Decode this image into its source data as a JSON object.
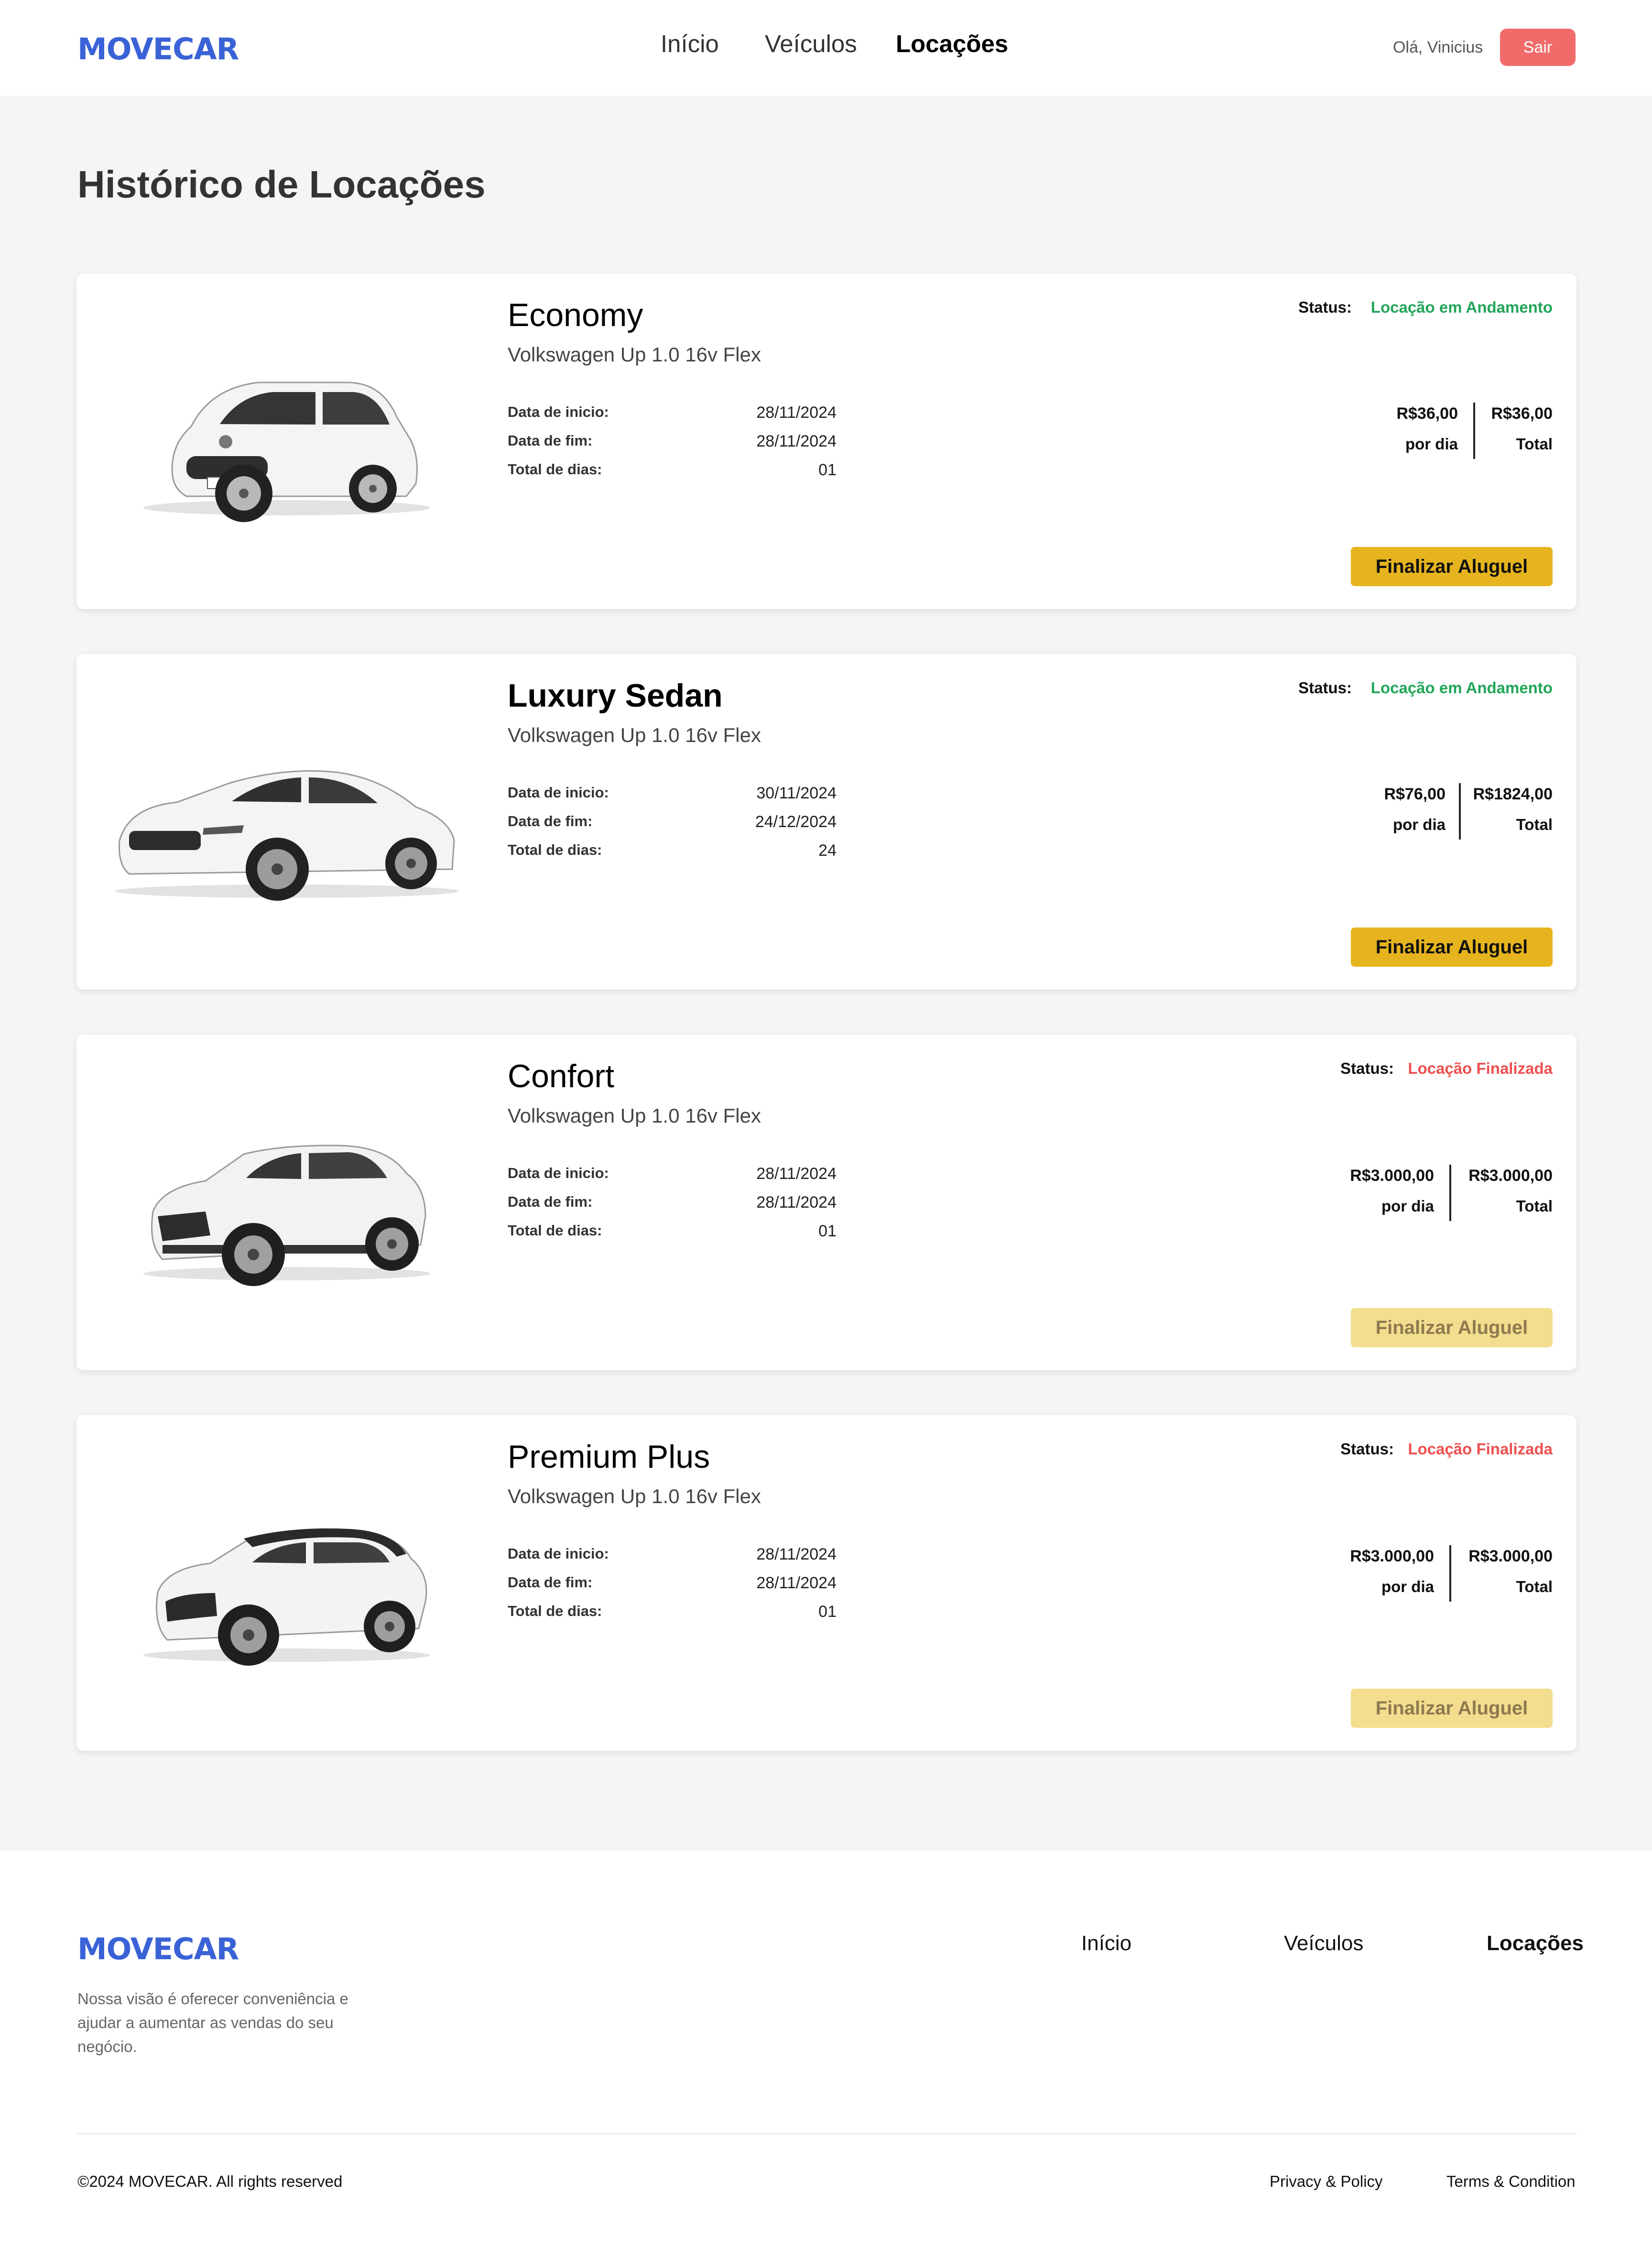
{
  "header": {
    "logo": "MOVECAR",
    "nav": [
      "Início",
      "Veículos",
      "Locações"
    ],
    "active_nav": "Locações",
    "greeting": "Olá, Vinicius",
    "logout_label": "Sair"
  },
  "page": {
    "title": "Histórico de Locações"
  },
  "labels": {
    "status": "Status:",
    "start": "Data de inicio:",
    "end": "Data de fim:",
    "days": "Total de dias:",
    "per_day": "por dia",
    "total": "Total",
    "finalize": "Finalizar Aluguel"
  },
  "rentals": [
    {
      "category": "Economy",
      "model": "Volkswagen Up 1.0 16v Flex",
      "status": "Locação em Andamento",
      "start": "28/11/2024",
      "end": "28/11/2024",
      "days": "01",
      "price_per_day": "R$36,00",
      "price_total": "R$36,00",
      "button_enabled": true
    },
    {
      "category": "Luxury Sedan",
      "model": "Volkswagen Up 1.0 16v Flex",
      "status": "Locação em Andamento",
      "start": "30/11/2024",
      "end": "24/12/2024",
      "days": "24",
      "price_per_day": "R$76,00",
      "price_total": "R$1824,00",
      "button_enabled": true
    },
    {
      "category": "Confort",
      "model": "Volkswagen Up 1.0 16v Flex",
      "status": "Locação Finalizada",
      "start": "28/11/2024",
      "end": "28/11/2024",
      "days": "01",
      "price_per_day": "R$3.000,00",
      "price_total": "R$3.000,00",
      "button_enabled": false
    },
    {
      "category": "Premium Plus",
      "model": "Volkswagen Up 1.0 16v Flex",
      "status": "Locação Finalizada",
      "start": "28/11/2024",
      "end": "28/11/2024",
      "days": "01",
      "price_per_day": "R$3.000,00",
      "price_total": "R$3.000,00",
      "button_enabled": false
    }
  ],
  "colors": {
    "brand": "#3a62d7",
    "status_active": "#22a559",
    "status_finished": "#ef4f4f",
    "button": "#e6b41e",
    "button_disabled": "#f3dd8e",
    "logout": "#f26b6b"
  },
  "footer": {
    "logo": "MOVECAR",
    "tagline": "Nossa visão é oferecer conveniência e ajudar a aumentar as vendas do seu negócio.",
    "nav": [
      "Início",
      "Veículos",
      "Locações"
    ],
    "copyright": "©2024 MOVECAR. All rights reserved",
    "links": [
      "Privacy & Policy",
      "Terms & Condition"
    ]
  }
}
